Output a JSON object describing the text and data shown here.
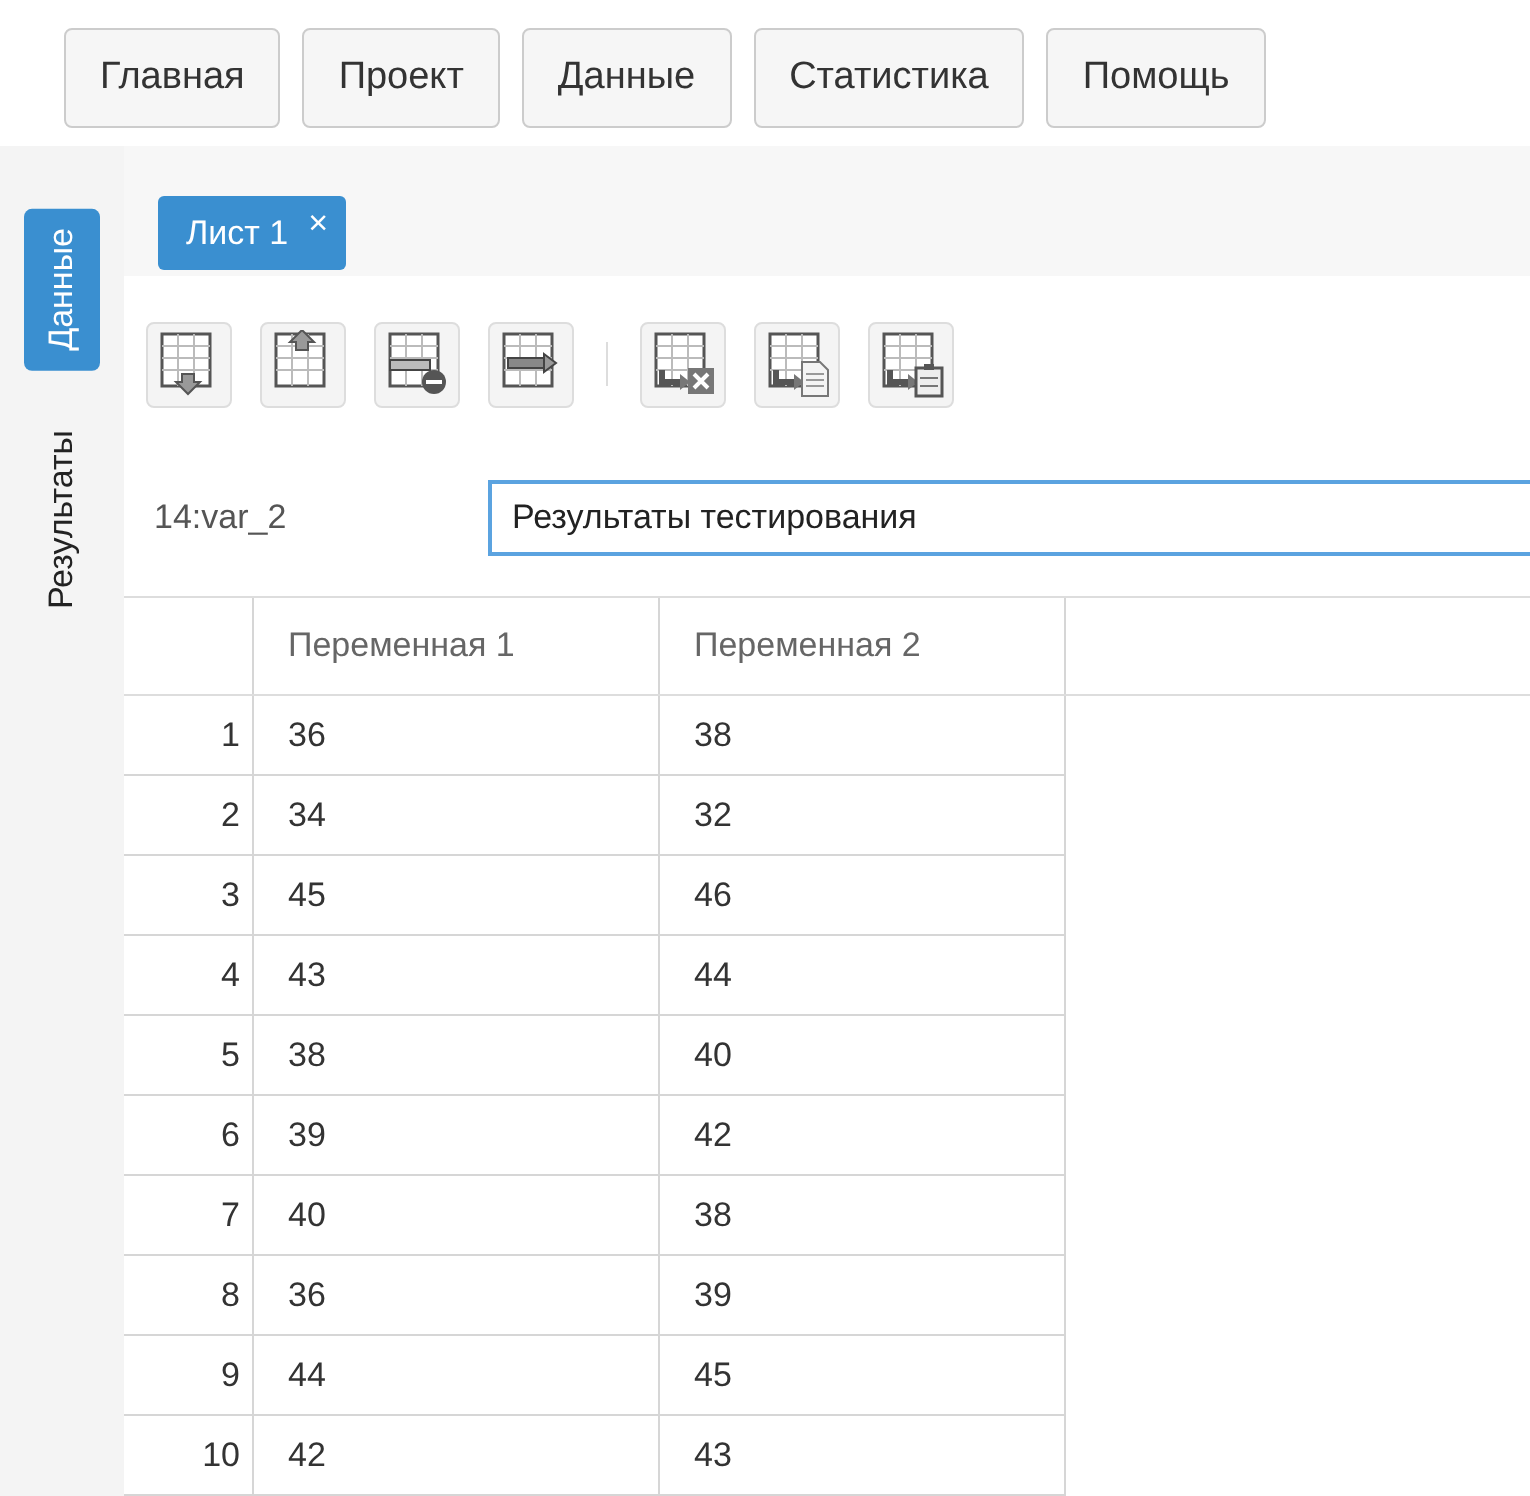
{
  "menu": [
    {
      "label": "Главная"
    },
    {
      "label": "Проект"
    },
    {
      "label": "Данные"
    },
    {
      "label": "Статистика"
    },
    {
      "label": "Помощь"
    }
  ],
  "side_tabs": [
    {
      "label": "Данные",
      "selected": true
    },
    {
      "label": "Результаты",
      "selected": false
    }
  ],
  "sheet_tabs": [
    {
      "label": "Лист 1",
      "close": "×",
      "selected": true
    }
  ],
  "cell_ref": "14:var_2",
  "cell_value": "Результаты тестирования",
  "table": {
    "columns": [
      "Переменная 1",
      "Переменная 2"
    ],
    "rows": [
      {
        "n": "1",
        "cells": [
          "36",
          "38"
        ]
      },
      {
        "n": "2",
        "cells": [
          "34",
          "32"
        ]
      },
      {
        "n": "3",
        "cells": [
          "45",
          "46"
        ]
      },
      {
        "n": "4",
        "cells": [
          "43",
          "44"
        ]
      },
      {
        "n": "5",
        "cells": [
          "38",
          "40"
        ]
      },
      {
        "n": "6",
        "cells": [
          "39",
          "42"
        ]
      },
      {
        "n": "7",
        "cells": [
          "40",
          "38"
        ]
      },
      {
        "n": "8",
        "cells": [
          "36",
          "39"
        ]
      },
      {
        "n": "9",
        "cells": [
          "44",
          "45"
        ]
      },
      {
        "n": "10",
        "cells": [
          "42",
          "43"
        ]
      }
    ]
  }
}
